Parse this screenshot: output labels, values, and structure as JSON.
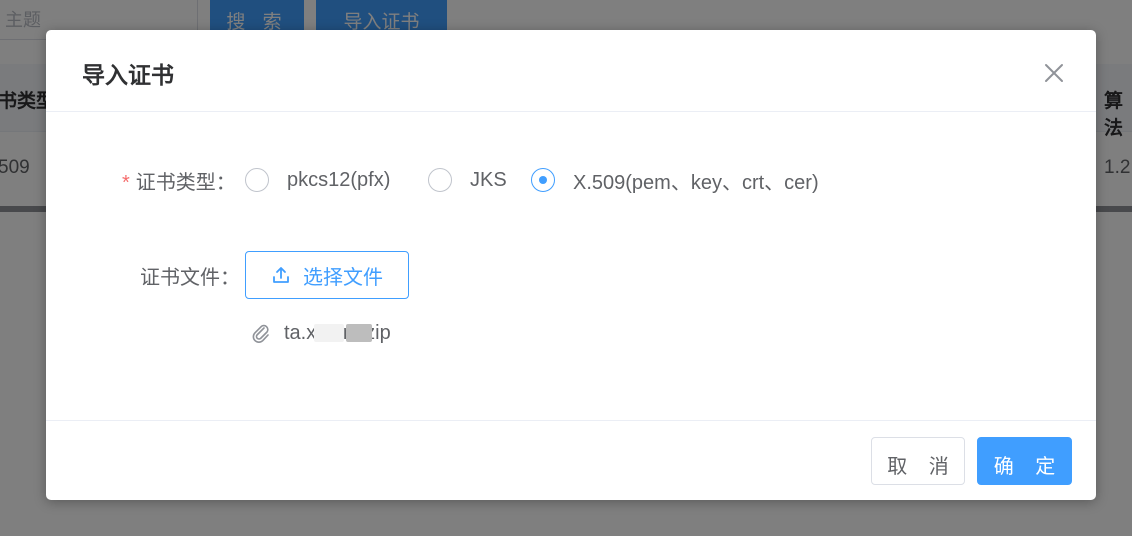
{
  "background": {
    "search_placeholder": "主题",
    "search_button": "搜 索",
    "import_button": "导入证书",
    "table_header_left": "书类型",
    "table_header_right": "算法",
    "table_cell_left": "509",
    "table_cell_right": "1.2"
  },
  "dialog": {
    "title": "导入证书",
    "cert_type_label": "证书类型：",
    "required_mark": "*",
    "cert_type_options": [
      {
        "label": "pkcs12(pfx)",
        "checked": false
      },
      {
        "label": "JKS",
        "checked": false
      },
      {
        "label": "X.509(pem、key、crt、cer)",
        "checked": true
      }
    ],
    "cert_file_label": "证书文件：",
    "upload_button": "选择文件",
    "uploaded_file": "ta.x.com.zip",
    "cancel_button": "取 消",
    "confirm_button": "确 定"
  },
  "colors": {
    "primary": "#409eff",
    "required": "#f56c6c",
    "text": "#606266",
    "title": "#303133"
  },
  "icons": {
    "close": "close-icon",
    "upload": "upload-icon",
    "attachment": "paperclip-icon"
  }
}
